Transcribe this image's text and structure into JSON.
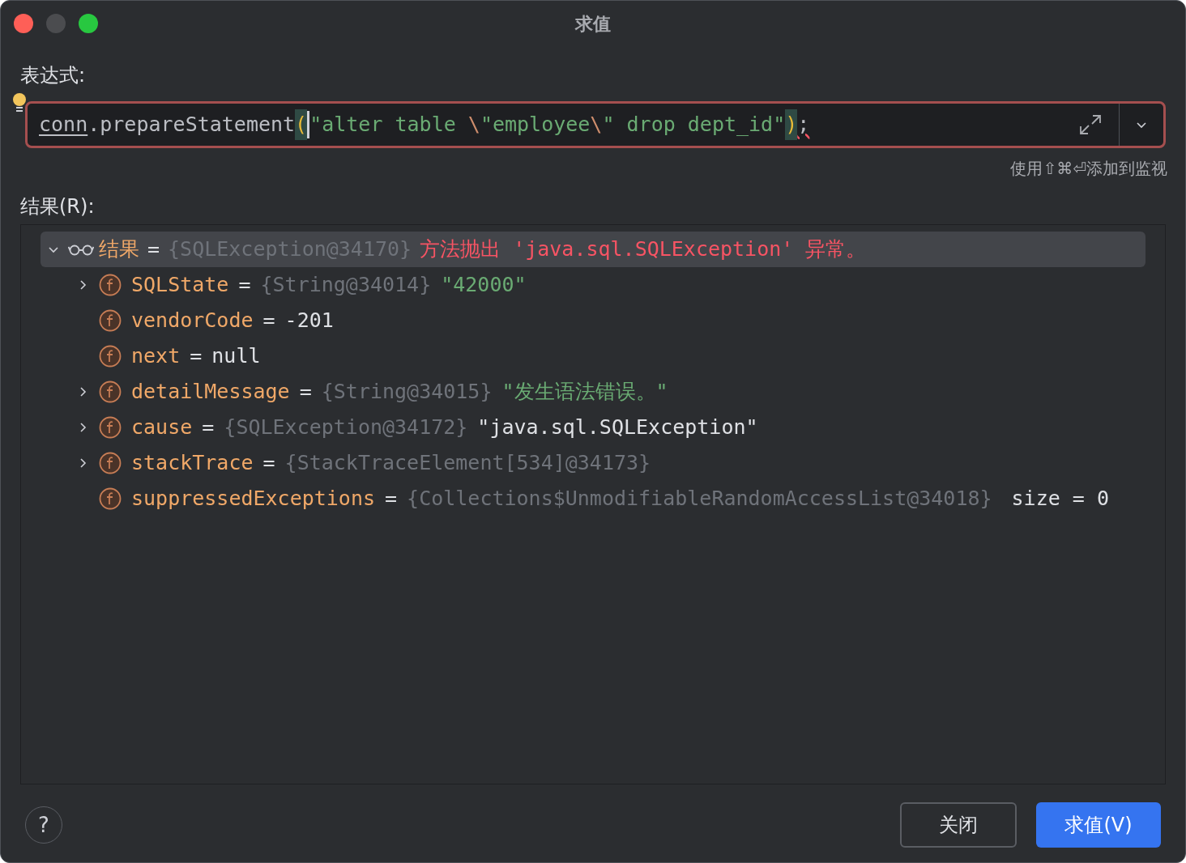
{
  "window": {
    "title": "求值"
  },
  "expression": {
    "label": "表达式:",
    "tokens": [
      {
        "kind": "ident",
        "text": "conn"
      },
      {
        "kind": "plain",
        "text": ".prepareStatement"
      },
      {
        "kind": "paren",
        "text": "("
      },
      {
        "kind": "string",
        "text": "\"alter table "
      },
      {
        "kind": "escape",
        "text": "\\"
      },
      {
        "kind": "string",
        "text": "\"employee"
      },
      {
        "kind": "escape",
        "text": "\\"
      },
      {
        "kind": "string",
        "text": "\" drop dept_id\""
      },
      {
        "kind": "paren",
        "text": ")"
      },
      {
        "kind": "error",
        "text": ";"
      }
    ],
    "hint": "使用⇧⌘⏎添加到监视"
  },
  "result": {
    "label": "结果(R):",
    "root": {
      "name": "结果",
      "eq": "=",
      "expanded": true,
      "selected": true,
      "type": "{SQLException@34170}",
      "message": "方法抛出 'java.sql.SQLException' 异常。",
      "children": [
        {
          "name": "SQLState",
          "eq": "=",
          "expandable": true,
          "type": "{String@34014}",
          "value": "\"42000\"",
          "kind": "string"
        },
        {
          "name": "vendorCode",
          "eq": "=",
          "expandable": false,
          "value": "-201",
          "kind": "plain"
        },
        {
          "name": "next",
          "eq": "=",
          "expandable": false,
          "value": "null",
          "kind": "plain"
        },
        {
          "name": "detailMessage",
          "eq": "=",
          "expandable": true,
          "type": "{String@34015}",
          "value": "\"发生语法错误。\"",
          "kind": "string"
        },
        {
          "name": "cause",
          "eq": "=",
          "expandable": true,
          "type": "{SQLException@34172}",
          "value": "\"java.sql.SQLException\"",
          "kind": "plain"
        },
        {
          "name": "stackTrace",
          "eq": "=",
          "expandable": true,
          "type": "{StackTraceElement[534]@34173}"
        },
        {
          "name": "suppressedExceptions",
          "eq": "=",
          "expandable": false,
          "type": "{Collections$UnmodifiableRandomAccessList@34018}",
          "extra": "size = 0"
        }
      ]
    }
  },
  "buttons": [
    {
      "kind": "help",
      "label": "?"
    },
    {
      "kind": "secondary",
      "label": "关闭"
    },
    {
      "kind": "primary",
      "label": "求值(V)"
    }
  ]
}
